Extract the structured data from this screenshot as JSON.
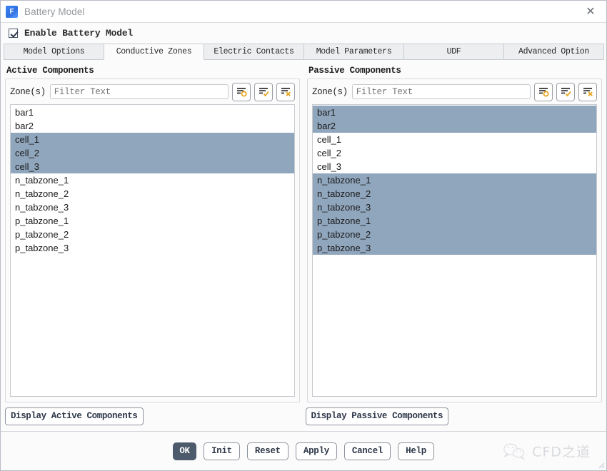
{
  "window": {
    "title": "Battery Model",
    "app_icon": "fluent-f-icon",
    "close_icon": "close-icon"
  },
  "enable": {
    "label": "Enable Battery Model",
    "checked": true
  },
  "tabs": [
    {
      "label": "Model Options",
      "active": false
    },
    {
      "label": "Conductive Zones",
      "active": true
    },
    {
      "label": "Electric Contacts",
      "active": false
    },
    {
      "label": "Model Parameters",
      "active": false
    },
    {
      "label": "UDF",
      "active": false
    },
    {
      "label": "Advanced Option",
      "active": false
    }
  ],
  "active_panel": {
    "title": "Active Components",
    "zone_label": "Zone(s)",
    "filter_placeholder": "Filter Text",
    "filter_value": "",
    "icon_buttons": [
      {
        "name": "filter-list-circle-icon",
        "glyph": "o"
      },
      {
        "name": "filter-list-check-icon",
        "glyph": "check"
      },
      {
        "name": "filter-list-x-icon",
        "glyph": "x"
      }
    ],
    "items": [
      {
        "label": "bar1",
        "selected": false
      },
      {
        "label": "bar2",
        "selected": false
      },
      {
        "label": "cell_1",
        "selected": true
      },
      {
        "label": "cell_2",
        "selected": true
      },
      {
        "label": "cell_3",
        "selected": true
      },
      {
        "label": "n_tabzone_1",
        "selected": false
      },
      {
        "label": "n_tabzone_2",
        "selected": false
      },
      {
        "label": "n_tabzone_3",
        "selected": false
      },
      {
        "label": "p_tabzone_1",
        "selected": false
      },
      {
        "label": "p_tabzone_2",
        "selected": false
      },
      {
        "label": "p_tabzone_3",
        "selected": false
      }
    ],
    "display_button": "Display Active Components"
  },
  "passive_panel": {
    "title": "Passive Components",
    "zone_label": "Zone(s)",
    "filter_placeholder": "Filter Text",
    "filter_value": "",
    "icon_buttons": [
      {
        "name": "filter-list-circle-icon",
        "glyph": "o"
      },
      {
        "name": "filter-list-check-icon",
        "glyph": "check"
      },
      {
        "name": "filter-list-x-icon",
        "glyph": "x"
      }
    ],
    "items": [
      {
        "label": "bar1",
        "selected": true
      },
      {
        "label": "bar2",
        "selected": true
      },
      {
        "label": "cell_1",
        "selected": false
      },
      {
        "label": "cell_2",
        "selected": false
      },
      {
        "label": "cell_3",
        "selected": false
      },
      {
        "label": "n_tabzone_1",
        "selected": true
      },
      {
        "label": "n_tabzone_2",
        "selected": true
      },
      {
        "label": "n_tabzone_3",
        "selected": true
      },
      {
        "label": "p_tabzone_1",
        "selected": true
      },
      {
        "label": "p_tabzone_2",
        "selected": true
      },
      {
        "label": "p_tabzone_3",
        "selected": true
      }
    ],
    "display_button": "Display Passive Components"
  },
  "footer": {
    "buttons": [
      {
        "label": "OK",
        "primary": true
      },
      {
        "label": "Init",
        "primary": false
      },
      {
        "label": "Reset",
        "primary": false
      },
      {
        "label": "Apply",
        "primary": false
      },
      {
        "label": "Cancel",
        "primary": false
      },
      {
        "label": "Help",
        "primary": false
      }
    ],
    "watermark_text": "CFD之道",
    "watermark_icon": "wechat-icon"
  },
  "colors": {
    "selection": "#90a6bd",
    "primary_button": "#4c5a6b",
    "icon_accent": "#e8a317",
    "app_icon": "#3b86f7"
  }
}
